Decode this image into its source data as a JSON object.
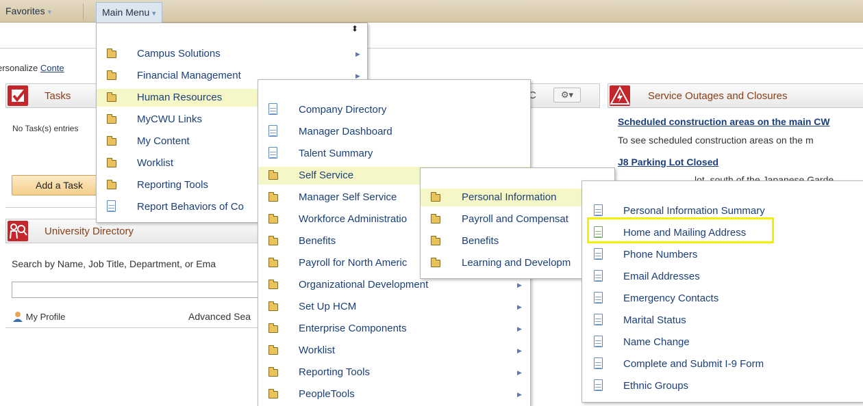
{
  "topbar": {
    "favorites": "Favorites",
    "main_menu": "Main Menu",
    "caret": "▾"
  },
  "personalize": {
    "prefix": "ersonalize",
    "link": "Conte"
  },
  "tasks": {
    "title": "Tasks",
    "empty": "No Task(s) entries",
    "add_button": "Add a Task"
  },
  "university_directory": {
    "title": "University Directory",
    "search_label": "Search by Name, Job Title, Department, or Ema",
    "search_value": "",
    "my_profile": "My Profile",
    "advanced_search": "Advanced Sea"
  },
  "middle_pagelet": {
    "title_fragment": "C",
    "gear": "⚙▾"
  },
  "service_outages": {
    "title": "Service Outages and Closures",
    "link1": "Scheduled construction areas on the main CW",
    "text1": "To see scheduled construction areas on the m",
    "link2": "J8 Parking Lot Closed",
    "text2": "lot, south of the Japanese Garde"
  },
  "main_menu": {
    "sort_icon": "⬍",
    "items": [
      {
        "label": "Campus Solutions",
        "icon": "folder-icon",
        "arrow": true
      },
      {
        "label": "Financial Management",
        "icon": "folder-icon",
        "arrow": true
      },
      {
        "label": "Human Resources",
        "icon": "folder-icon",
        "arrow": false,
        "selected": true
      },
      {
        "label": "MyCWU Links",
        "icon": "folder-icon",
        "arrow": false
      },
      {
        "label": "My Content",
        "icon": "folder-icon",
        "arrow": false
      },
      {
        "label": "Worklist",
        "icon": "folder-icon",
        "arrow": false
      },
      {
        "label": "Reporting Tools",
        "icon": "folder-icon",
        "arrow": false
      },
      {
        "label": "Report Behaviors of Co",
        "icon": "document-icon",
        "arrow": false
      }
    ]
  },
  "hr_menu": {
    "items": [
      {
        "label": "Company Directory",
        "icon": "document-icon"
      },
      {
        "label": "Manager Dashboard",
        "icon": "document-icon"
      },
      {
        "label": "Talent Summary",
        "icon": "document-icon"
      },
      {
        "label": "Self Service",
        "icon": "folder-icon",
        "selected": true
      },
      {
        "label": "Manager Self Service",
        "icon": "folder-icon"
      },
      {
        "label": "Workforce Administratio",
        "icon": "folder-icon"
      },
      {
        "label": "Benefits",
        "icon": "folder-icon"
      },
      {
        "label": "Payroll for North Americ",
        "icon": "folder-icon"
      },
      {
        "label": "Organizational Development",
        "icon": "folder-icon",
        "arrow": true
      },
      {
        "label": "Set Up HCM",
        "icon": "folder-icon",
        "arrow": true
      },
      {
        "label": "Enterprise Components",
        "icon": "folder-icon",
        "arrow": true
      },
      {
        "label": "Worklist",
        "icon": "folder-icon",
        "arrow": true
      },
      {
        "label": "Reporting Tools",
        "icon": "folder-icon",
        "arrow": true
      },
      {
        "label": "PeopleTools",
        "icon": "folder-icon",
        "arrow": true
      }
    ]
  },
  "self_service_menu": {
    "items": [
      {
        "label": "Personal Information",
        "icon": "folder-icon",
        "selected": true
      },
      {
        "label": "Payroll and Compensat",
        "icon": "folder-icon"
      },
      {
        "label": "Benefits",
        "icon": "folder-icon"
      },
      {
        "label": "Learning and Developm",
        "icon": "folder-icon"
      }
    ]
  },
  "personal_info_menu": {
    "items": [
      {
        "label": "Personal Information Summary",
        "icon": "document-icon"
      },
      {
        "label": "Home and Mailing Address",
        "icon": "document-icon",
        "highlighted": true
      },
      {
        "label": "Phone Numbers",
        "icon": "document-icon"
      },
      {
        "label": "Email Addresses",
        "icon": "document-icon"
      },
      {
        "label": "Emergency Contacts",
        "icon": "document-icon"
      },
      {
        "label": "Marital Status",
        "icon": "document-icon"
      },
      {
        "label": "Name Change",
        "icon": "document-icon"
      },
      {
        "label": "Complete and Submit I-9 Form",
        "icon": "document-icon"
      },
      {
        "label": "Ethnic Groups",
        "icon": "document-icon"
      }
    ]
  },
  "colors": {
    "highlight": "#f2f200",
    "menu_selected": "#f5f8c6",
    "link": "#1a3f7a",
    "pagelet_title": "#8a3e16"
  }
}
